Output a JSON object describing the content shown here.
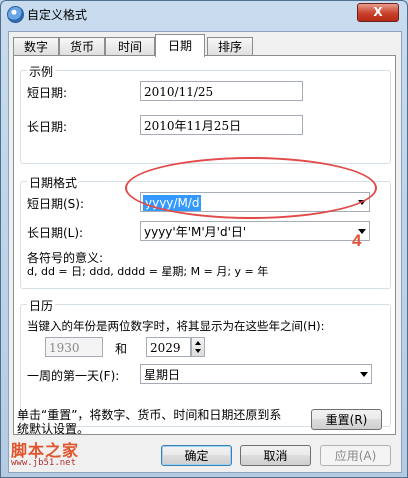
{
  "window": {
    "title": "自定义格式",
    "close": "X"
  },
  "tabs": [
    {
      "label": "数字"
    },
    {
      "label": "货币"
    },
    {
      "label": "时间"
    },
    {
      "label": "日期"
    },
    {
      "label": "排序"
    }
  ],
  "examples": {
    "group": "示例",
    "short_label": "短日期:",
    "short_value": "2010/11/25",
    "long_label": "长日期:",
    "long_value": "2010年11月25日"
  },
  "date_formats": {
    "group": "日期格式",
    "short_label": "短日期(S):",
    "short_value": "yyyy/M/d",
    "long_label": "长日期(L):",
    "long_value": "yyyy'年'M'月'd'日'",
    "legend_title": "各符号的意义:",
    "legend_text": "d, dd = 日;  ddd, dddd = 星期;  M = 月;  y = 年"
  },
  "calendar": {
    "group": "日历",
    "two_digit_label": "当键入的年份是两位数字时，将其显示为在这些年之间(H):",
    "start_year": "1930",
    "and_label": "和",
    "end_year": "2029",
    "first_day_label": "一周的第一天(F):",
    "first_day_value": "星期日"
  },
  "footer": {
    "reset_text_line1": "单击“重置”，将数字、货币、时间和日期还原到系",
    "reset_text_line2": "统默认设置。",
    "reset_button": "重置(R)",
    "ok_button": "确定",
    "cancel_button": "取消",
    "apply_button": "应用(A)"
  },
  "annotation": {
    "number": "4"
  },
  "watermark": {
    "main": "脚本之家",
    "sub": "www.jb51.net"
  }
}
